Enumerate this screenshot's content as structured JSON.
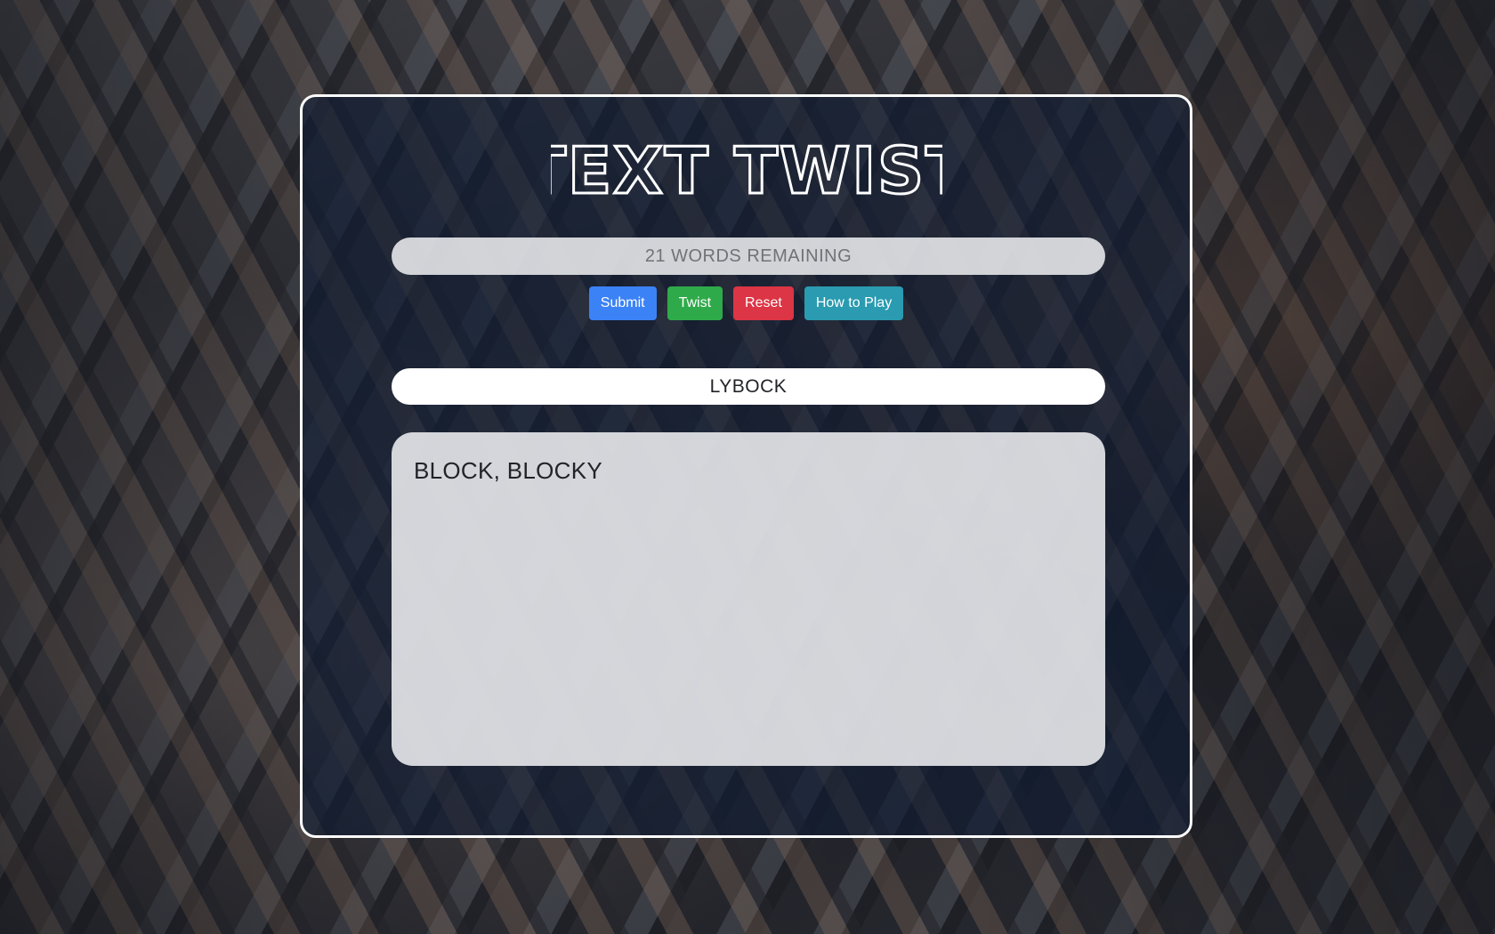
{
  "title": "TEXT TWIST",
  "status": {
    "remaining": "21 WORDS REMAINING"
  },
  "buttons": {
    "submit": "Submit",
    "twist": "Twist",
    "reset": "Reset",
    "help": "How to Play"
  },
  "letters": "LYBOCK",
  "found_words": "BLOCK, BLOCKY",
  "colors": {
    "submit": "#3b82f6",
    "twist": "#2faa4a",
    "reset": "#dc3545",
    "help": "#2a9bb0",
    "panel_border": "#ffffff"
  }
}
